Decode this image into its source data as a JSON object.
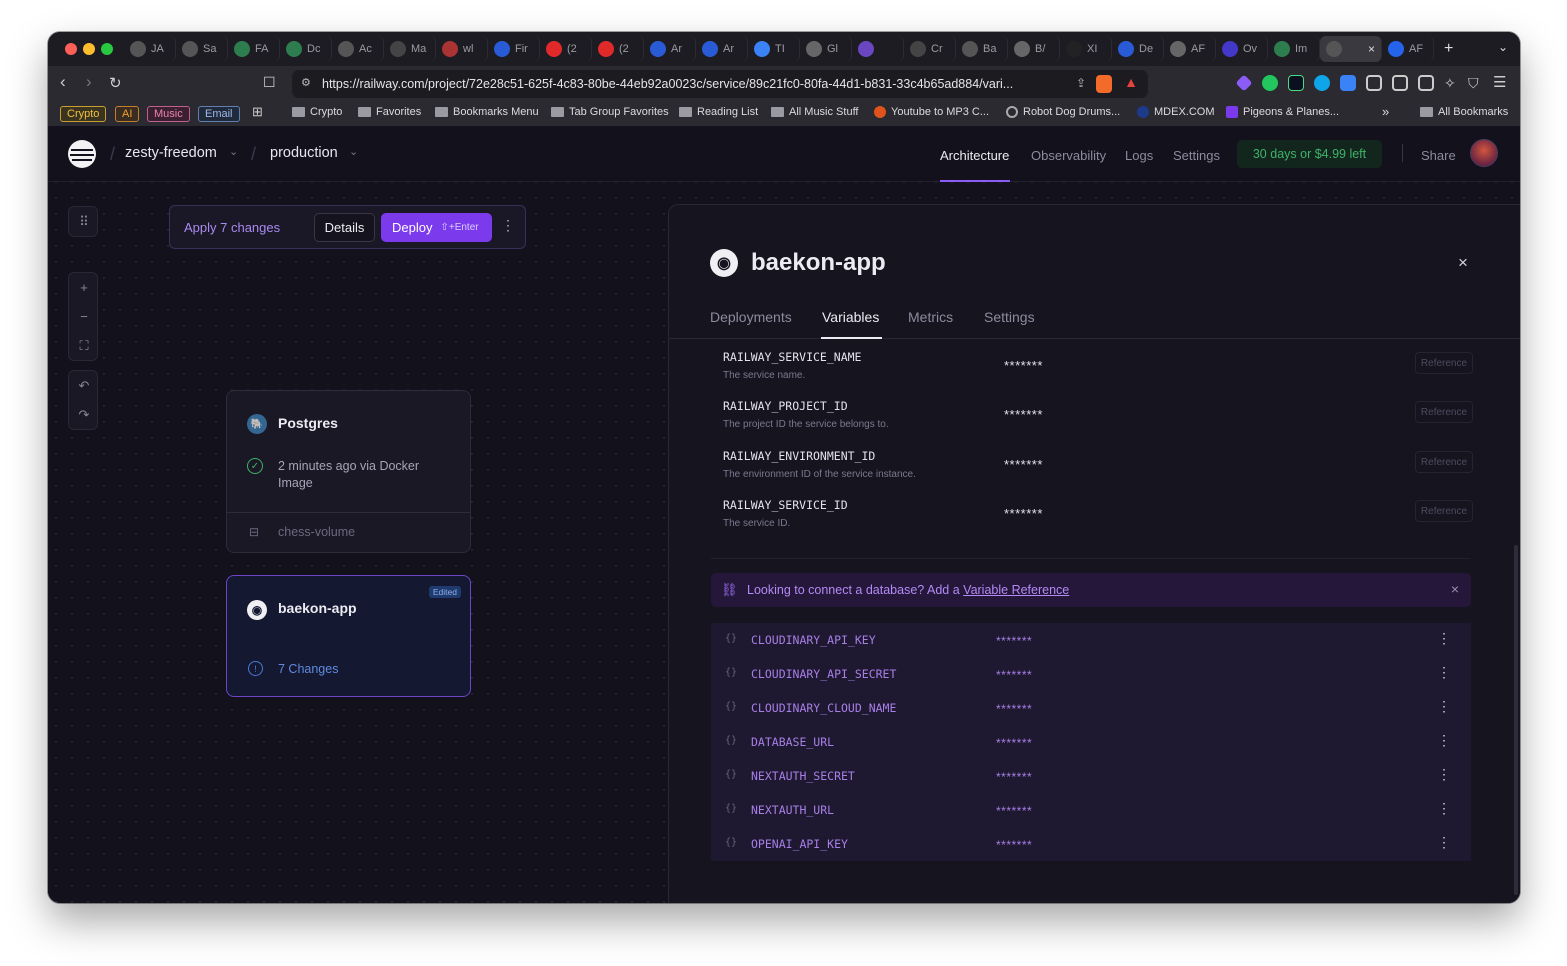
{
  "browser": {
    "tabs": [
      {
        "label": "JA",
        "icon": "railway-icon",
        "color": "#555"
      },
      {
        "label": "Sa",
        "icon": "railway-icon",
        "color": "#555"
      },
      {
        "label": "FA",
        "icon": "green-icon",
        "color": "#2e7d4f"
      },
      {
        "label": "Dc",
        "icon": "green-icon",
        "color": "#2e7d4f"
      },
      {
        "label": "Ac",
        "icon": "railway-icon",
        "color": "#555"
      },
      {
        "label": "Ma",
        "icon": "face-icon",
        "color": "#444"
      },
      {
        "label": "wl",
        "icon": "shield-icon",
        "color": "#a33"
      },
      {
        "label": "Fir",
        "icon": "blue-icon",
        "color": "#2a5bd7"
      },
      {
        "label": "(2",
        "icon": "youtube-icon",
        "color": "#e02a2a"
      },
      {
        "label": "(2",
        "icon": "youtube-icon",
        "color": "#e02a2a"
      },
      {
        "label": "Ar",
        "icon": "blue-icon",
        "color": "#2a5bd7"
      },
      {
        "label": "Ar",
        "icon": "blue-icon",
        "color": "#2a5bd7"
      },
      {
        "label": "TI",
        "icon": "t-icon",
        "color": "#3b82f6"
      },
      {
        "label": "Gl",
        "icon": "gray-icon",
        "color": "#666"
      },
      {
        "label": "",
        "icon": "purple-icon",
        "color": "#6b46c1"
      },
      {
        "label": "Cr",
        "icon": "ts-icon",
        "color": "#444"
      },
      {
        "label": "Ba",
        "icon": "railway-icon",
        "color": "#555"
      },
      {
        "label": "B/",
        "icon": "gray-icon",
        "color": "#666"
      },
      {
        "label": "XI",
        "icon": "github-icon",
        "color": "#222"
      },
      {
        "label": "De",
        "icon": "blue-icon",
        "color": "#2a5bd7"
      },
      {
        "label": "AF",
        "icon": "gray-icon",
        "color": "#666"
      },
      {
        "label": "Ov",
        "icon": "blue-icon",
        "color": "#4338ca"
      },
      {
        "label": "Im",
        "icon": "green-icon",
        "color": "#2e7d4f"
      },
      {
        "label": "",
        "icon": "railway-icon",
        "color": "#555",
        "active": true
      },
      {
        "label": "AF",
        "icon": "blue-icon",
        "color": "#2563eb"
      }
    ],
    "url": "https://railway.com/project/72e28c51-625f-4c83-80be-44eb92a0023c/service/89c21fc0-80fa-44d1-b831-33c4b65ad884/vari...",
    "bookmark_tags": [
      "Crypto",
      "AI",
      "Music",
      "Email"
    ],
    "bookmarks": [
      "Crypto",
      "Favorites",
      "Bookmarks Menu",
      "Tab Group Favorites",
      "Reading List",
      "All Music Stuff",
      "Youtube to MP3 C...",
      "Robot Dog Drums...",
      "MDEX.COM",
      "Pigeons & Planes...",
      "All Bookmarks"
    ]
  },
  "topnav": {
    "project": "zesty-freedom",
    "environment": "production",
    "links": [
      "Architecture",
      "Observability",
      "Logs",
      "Settings"
    ],
    "trial": "30 days or $4.99 left",
    "share": "Share"
  },
  "canvas": {
    "apply_label": "Apply 7 changes",
    "details_label": "Details",
    "deploy_label": "Deploy",
    "deploy_shortcut": "⇧+Enter",
    "postgres": {
      "name": "Postgres",
      "status": "2 minutes ago via Docker Image",
      "volume": "chess-volume"
    },
    "app": {
      "name": "baekon-app",
      "badge": "Edited",
      "changes": "7 Changes"
    }
  },
  "panel": {
    "title": "baekon-app",
    "tabs": [
      "Deployments",
      "Variables",
      "Metrics",
      "Settings"
    ],
    "active_tab": "Variables",
    "system_vars": [
      {
        "name": "RAILWAY_SERVICE_NAME",
        "desc": "The service name.",
        "value": "*******",
        "ref": "Reference"
      },
      {
        "name": "RAILWAY_PROJECT_ID",
        "desc": "The project ID the service belongs to.",
        "value": "*******",
        "ref": "Reference"
      },
      {
        "name": "RAILWAY_ENVIRONMENT_ID",
        "desc": "The environment ID of the service instance.",
        "value": "*******",
        "ref": "Reference"
      },
      {
        "name": "RAILWAY_SERVICE_ID",
        "desc": "The service ID.",
        "value": "*******",
        "ref": "Reference"
      }
    ],
    "banner": {
      "text": "Looking to connect a database? Add a ",
      "link": "Variable Reference"
    },
    "user_vars": [
      {
        "name": "CLOUDINARY_API_KEY",
        "value": "*******"
      },
      {
        "name": "CLOUDINARY_API_SECRET",
        "value": "*******"
      },
      {
        "name": "CLOUDINARY_CLOUD_NAME",
        "value": "*******"
      },
      {
        "name": "DATABASE_URL",
        "value": "*******"
      },
      {
        "name": "NEXTAUTH_SECRET",
        "value": "*******"
      },
      {
        "name": "NEXTAUTH_URL",
        "value": "*******"
      },
      {
        "name": "OPENAI_API_KEY",
        "value": "*******"
      }
    ],
    "brace": "{}"
  },
  "colors": {
    "accent": "#8b5cf6",
    "deploy_bg": "#7c3aed",
    "trial_bg": "#13261d",
    "trial_text": "#3fb26a",
    "user_var_text": "#a77fe6"
  }
}
